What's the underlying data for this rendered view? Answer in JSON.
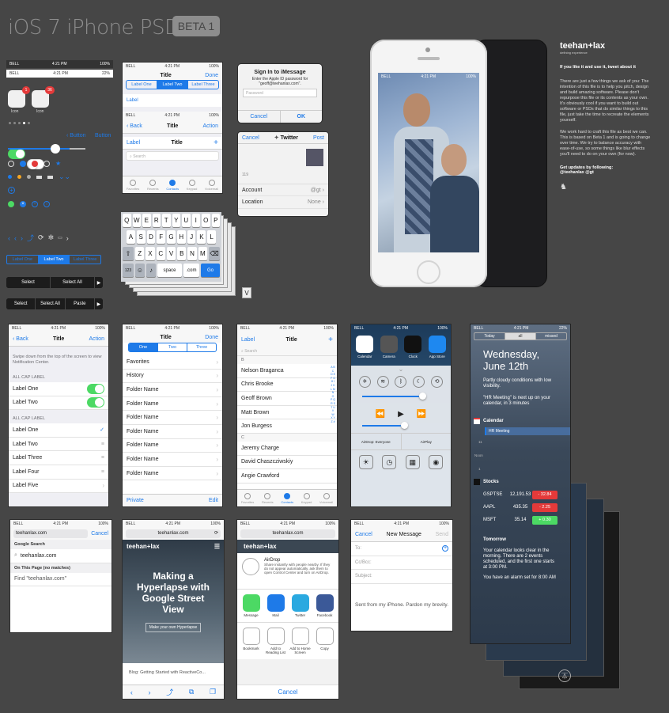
{
  "header": {
    "title": "iOS 7 iPhone PSD",
    "badge": "BETA 1"
  },
  "status": {
    "carrier": "BELL",
    "time": "4:21 PM",
    "battery": "100%",
    "battery2": "22%"
  },
  "controls": {
    "icon_label": "Icon",
    "badge1": "1",
    "badge2": "36",
    "back_button": "Button",
    "plain_button": "Button",
    "seg": [
      "Label One",
      "Label Two",
      "Label Three"
    ],
    "menu1": [
      "Select",
      "Select All"
    ],
    "menu2": [
      "Select",
      "Select All",
      "Paste"
    ]
  },
  "nav_panel": {
    "title": "Title",
    "done": "Done",
    "seg": [
      "Label One",
      "Label Two",
      "Label Three"
    ],
    "label": "Label",
    "back": "Back",
    "action": "Action",
    "label2": "Label",
    "search": "Search",
    "tabs": [
      "Favorites",
      "Recents",
      "Contacts",
      "Keypad",
      "Voicemail"
    ]
  },
  "imessage": {
    "title": "Sign In to iMessage",
    "msg": "Enter the Apple ID password for \"geoff@teehanlax.com\".",
    "placeholder": "Password",
    "cancel": "Cancel",
    "ok": "OK"
  },
  "twitter": {
    "cancel": "Cancel",
    "title": "Twitter",
    "post": "Post",
    "count": "119",
    "account_label": "Account",
    "account_value": "@gt",
    "location_label": "Location",
    "location_value": "None"
  },
  "keyboard": {
    "row1": [
      "Q",
      "W",
      "E",
      "R",
      "T",
      "Y",
      "U",
      "I",
      "O",
      "P"
    ],
    "row2": [
      "A",
      "S",
      "D",
      "F",
      "G",
      "H",
      "J",
      "K",
      "L"
    ],
    "row3": [
      "Z",
      "X",
      "C",
      "V",
      "B",
      "N",
      "M"
    ],
    "num": "123",
    "space": "space",
    "com": ".com",
    "go": "Go",
    "v": "V"
  },
  "sidebar": {
    "brand": "teehan+lax",
    "tagline": "defining experience",
    "tweet": "If you like it and use it, tweet about it",
    "p1": "There are just a few things we ask of you: The intention of this file is to help you pitch, design and build amazing software. Please don't repurpose this file or its contents as your own. It's obviously cool if you want to build out software or PSDs that do similar things to this file, just take the time to recreate the elements yourself.",
    "p2": "We work hard to craft this file as best we can. This is based on Beta 1 and is going to change over time. We try to balance accuracy with ease-of-use, so some things like blur effects you'll need to do on your own (for now).",
    "updates": "Get updates by following:",
    "handles": "@teehanlax  @gt"
  },
  "phone": {
    "carrier": "BELL",
    "time": "4:21 PM",
    "battery": "100%"
  },
  "settings": {
    "back": "Back",
    "title": "Title",
    "action": "Action",
    "hint": "Swipe down from the top of the screen to view Notification Center.",
    "section1": "ALL CAP LABEL",
    "toggles": [
      "Label One",
      "Label Two"
    ],
    "section2": "ALL CAP LABEL",
    "rows": [
      "Label One",
      "Label Two",
      "Label Three",
      "Label Four",
      "Label Five"
    ]
  },
  "folders": {
    "title": "Title",
    "done": "Done",
    "seg": [
      "One",
      "Two",
      "Three"
    ],
    "items": [
      "Favorites",
      "History",
      "Folder Name",
      "Folder Name",
      "Folder Name",
      "Folder Name",
      "Folder Name",
      "Folder Name",
      "Folder Name"
    ],
    "private": "Private",
    "edit": "Edit"
  },
  "contacts": {
    "label": "Label",
    "title": "Title",
    "search": "Search",
    "b": "B",
    "names_b": [
      "Nelson Braganca",
      "Chris Brooke",
      "Geoff Brown",
      "Matt Brown",
      "Jon Burgess"
    ],
    "c": "C",
    "names_c": [
      "Jeremy Charge",
      "David Chaszcziwskiy",
      "Angie Crawford"
    ],
    "tabs": [
      "Favorites",
      "Recents",
      "Contacts",
      "Keypad",
      "Voicemail"
    ]
  },
  "control_center": {
    "apps": [
      "Calendar",
      "Camera",
      "Clock",
      "App Store"
    ],
    "airdrop": "AirDrop: Everyone",
    "airplay": "AirPlay"
  },
  "notifications": {
    "tabs": [
      "Today",
      "all",
      "missed"
    ],
    "date": "Wednesday, June 12th",
    "weather": "Partly cloudy conditions with low visibility.",
    "meeting": "\"HR Meeting\" is next up on your calendar, in 3 minutes",
    "calendar_label": "Calendar",
    "event": "HR Meeting",
    "hour1": "11",
    "noon": "Noon",
    "hour2": "1",
    "stocks_label": "Stocks",
    "stocks": [
      {
        "sym": "GSPTSE",
        "price": "12,191.53",
        "chg": "- 32.84"
      },
      {
        "sym": "AAPL",
        "price": "435.35",
        "chg": "- 2.25"
      },
      {
        "sym": "MSFT",
        "price": "35.14",
        "chg": "+ 0.30"
      }
    ],
    "tomorrow": "Tomorrow",
    "forecast": "Your calendar looks clear in the morning. There are 2 events scheduled, and the first one starts at 3:00 PM.",
    "alarm": "You have an alarm set for 8:00 AM"
  },
  "search_panel": {
    "url": "teehanlax.com",
    "cancel": "Cancel",
    "google": "Google Search",
    "suggestion": "teehanlax.com",
    "onpage": "On This Page (no matches)",
    "find": "Find \"teehanlax.com\""
  },
  "safari": {
    "url": "teehanlax.com",
    "brand": "teehan+lax",
    "headline": "Making a Hyperlapse with Google Street View",
    "cta": "Make your own Hyperlapse",
    "blog": "Blog: Getting Started with ReactiveCo..."
  },
  "share": {
    "url": "teehanlax.com",
    "brand": "teehan+lax",
    "airdrop_title": "AirDrop",
    "airdrop_text": "Share instantly with people nearby. If they do not appear automatically, ask them to open Control Center and turn on AirDrop.",
    "apps": [
      "Message",
      "Mail",
      "Twitter",
      "Facebook"
    ],
    "actions": [
      "Bookmark",
      "Add to Reading List",
      "Add to Home Screen",
      "Copy"
    ],
    "cancel": "Cancel"
  },
  "message": {
    "cancel": "Cancel",
    "title": "New Message",
    "send": "Send",
    "to": "To:",
    "ccbcc": "Cc/Bcc:",
    "subject": "Subject:",
    "body": "Sent from my iPhone. Pardon my brevity."
  }
}
